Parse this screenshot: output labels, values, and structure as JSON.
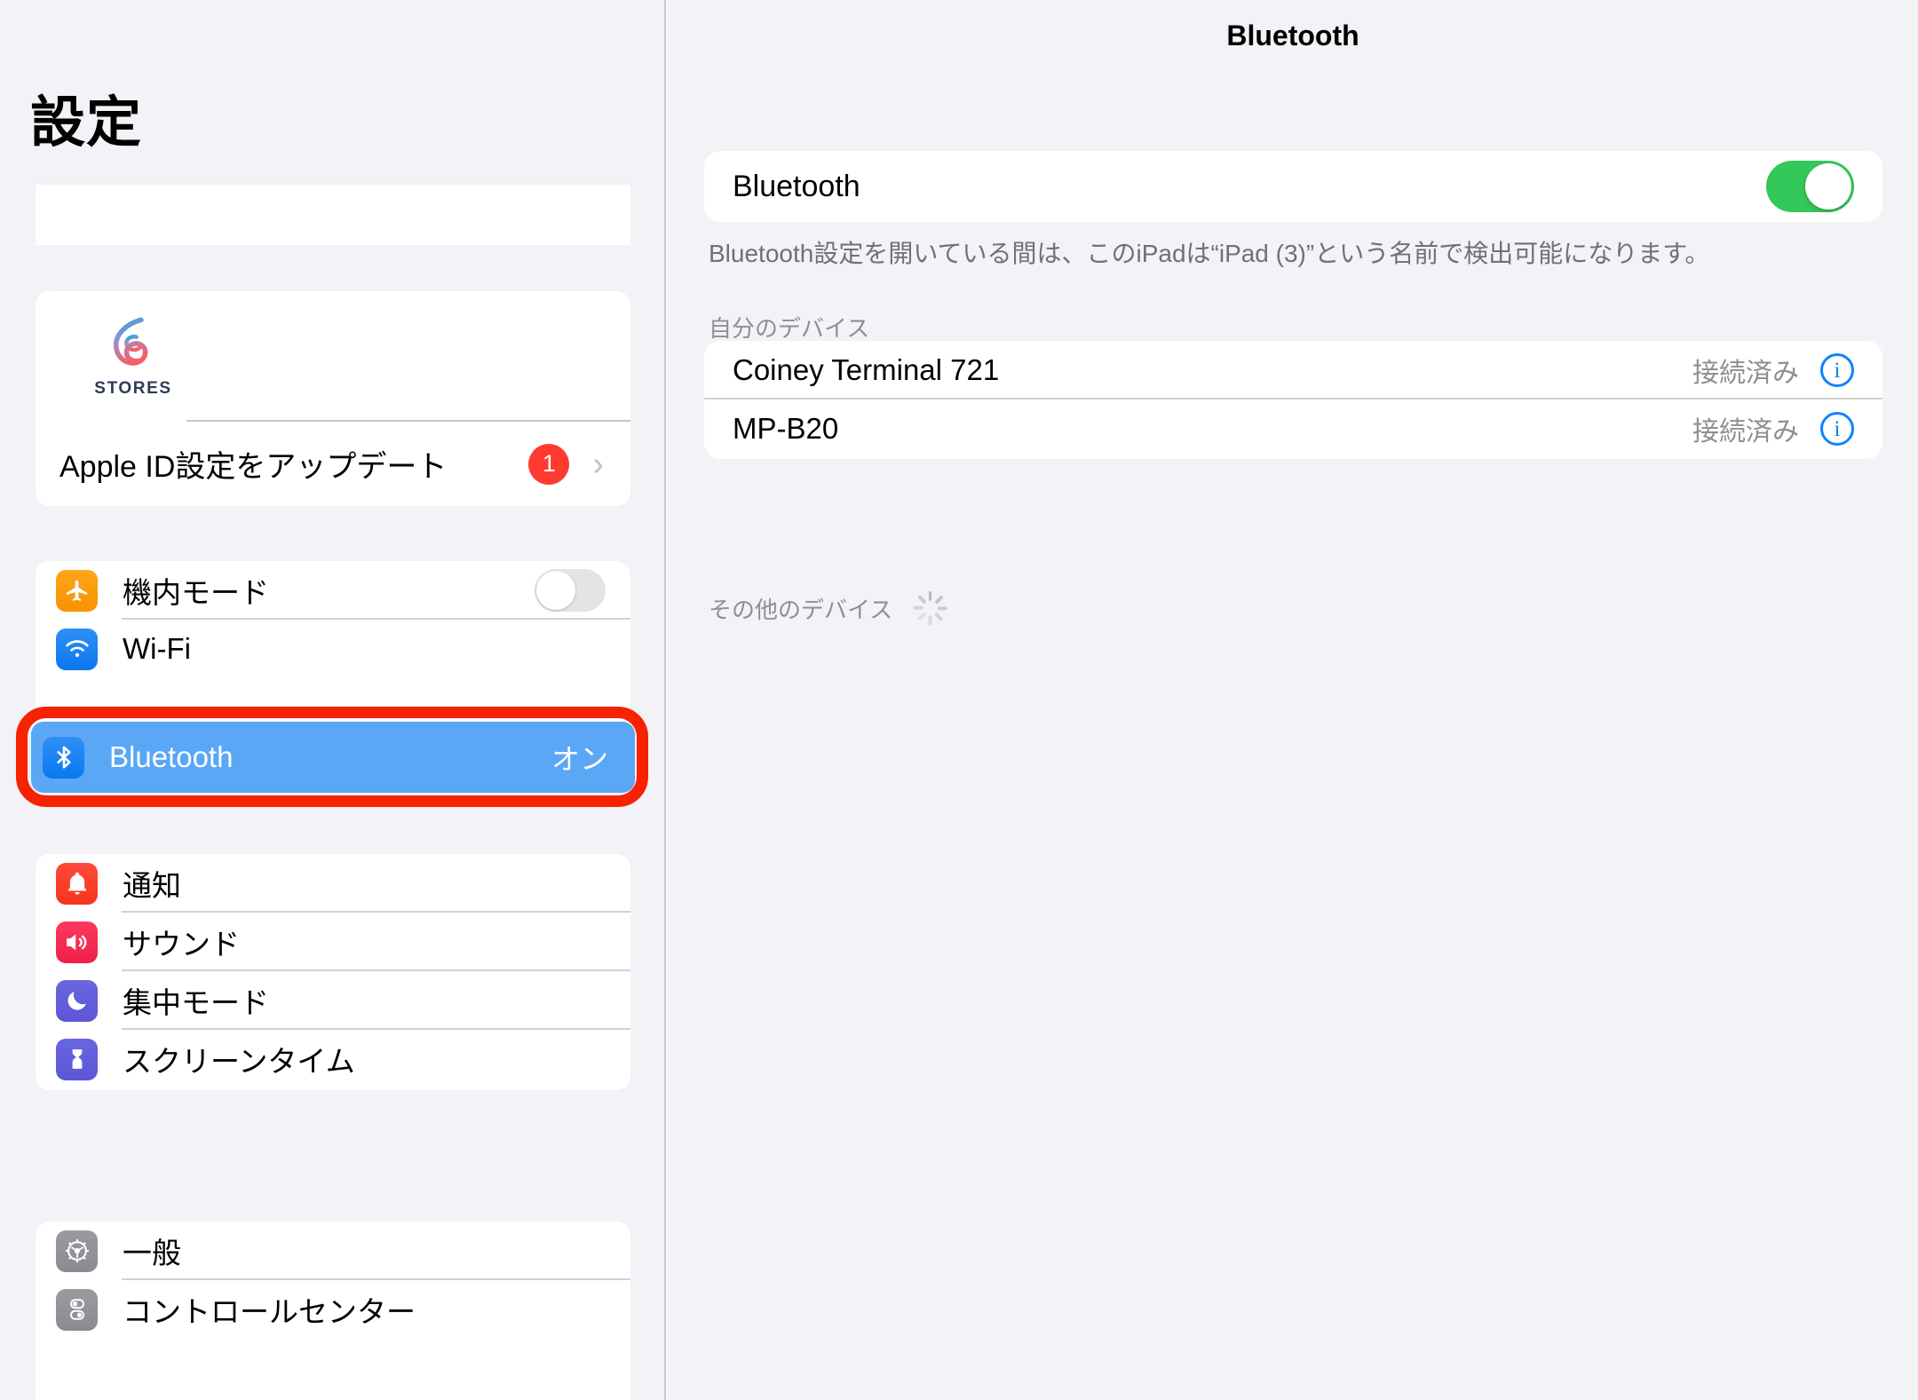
{
  "sidebar": {
    "title": "設定",
    "search_placeholder": "",
    "account": {
      "logo_text": "STORES",
      "update_label": "Apple ID設定をアップデート",
      "badge_count": "1",
      "chevron": "›"
    },
    "connectivity": [
      {
        "label": "機内モード",
        "icon": "airplane-icon",
        "control": "toggle-off",
        "value": ""
      },
      {
        "label": "Wi-Fi",
        "icon": "wifi-icon",
        "control": "none",
        "value": ""
      },
      {
        "label": "Bluetooth",
        "icon": "bluetooth-icon",
        "control": "value",
        "value": "オン",
        "selected": true
      }
    ],
    "notifications": [
      {
        "label": "通知",
        "icon": "bell-icon"
      },
      {
        "label": "サウンド",
        "icon": "speaker-icon"
      },
      {
        "label": "集中モード",
        "icon": "moon-icon"
      },
      {
        "label": "スクリーンタイム",
        "icon": "hourglass-icon"
      }
    ],
    "general": [
      {
        "label": "一般",
        "icon": "gear-icon"
      },
      {
        "label": "コントロールセンター",
        "icon": "switches-icon"
      }
    ]
  },
  "detail": {
    "title": "Bluetooth",
    "toggle_label": "Bluetooth",
    "toggle_state": "on",
    "description": "Bluetooth設定を開いている間は、このiPadは“iPad (3)”という名前で検出可能になります。",
    "my_devices_header": "自分のデバイス",
    "devices": [
      {
        "name": "Coiney Terminal 721",
        "status": "接続済み",
        "info": "i"
      },
      {
        "name": "MP-B20",
        "status": "接続済み",
        "info": "i"
      }
    ],
    "other_devices_header": "その他のデバイス",
    "scanning": true
  },
  "colors": {
    "page_background": "#f2f2f7",
    "card_background": "#ffffff",
    "selected_row": "#5aa7f5",
    "annotation_highlight": "#f72200",
    "toggle_on": "#34c759",
    "accent_blue": "#0a84ff",
    "badge_red": "#ff3b30",
    "secondary_text": "#8e8e93"
  }
}
